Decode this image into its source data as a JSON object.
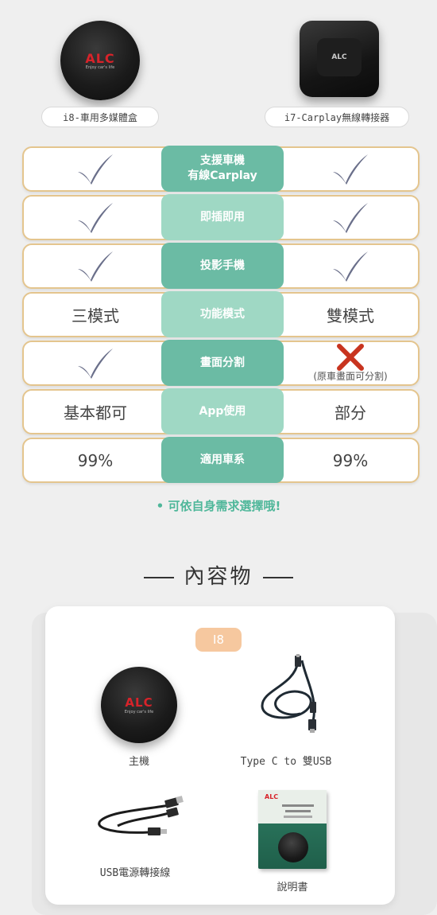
{
  "products": {
    "left": {
      "label": "i8-車用多媒體盒",
      "logo": "ALC",
      "tagline": "Enjoy car's life"
    },
    "right": {
      "label": "i7-Carplay無線轉接器",
      "logo": "ALC"
    }
  },
  "comparison": {
    "rows": [
      {
        "feature": "支援車機\n有線Carplay",
        "left": "check",
        "right": "check",
        "style": "dark"
      },
      {
        "feature": "即插即用",
        "left": "check",
        "right": "check",
        "style": "light"
      },
      {
        "feature": "投影手機",
        "left": "check",
        "right": "check",
        "style": "dark"
      },
      {
        "feature": "功能模式",
        "left": "三模式",
        "right": "雙模式",
        "style": "light"
      },
      {
        "feature": "畫面分割",
        "left": "check",
        "right": "cross",
        "right_note": "(原車畫面可分割)",
        "style": "dark"
      },
      {
        "feature": "App使用",
        "left": "基本都可",
        "right": "部分",
        "style": "light"
      },
      {
        "feature": "適用車系",
        "left": "99%",
        "right": "99%",
        "style": "dark"
      }
    ]
  },
  "tip": "• 可依自身需求選擇哦!",
  "contents": {
    "title": "內容物",
    "badge": "I8",
    "items": [
      {
        "label": "主機",
        "logo": "ALC",
        "tagline": "Enjoy car's life"
      },
      {
        "label": "Type C to 雙USB"
      },
      {
        "label": "USB電源轉接線"
      },
      {
        "label": "說明書",
        "cover_logo": "ALC"
      }
    ]
  },
  "colors": {
    "accent_dark": "#6bbba4",
    "accent_light": "#9fd8c4",
    "row_border": "#e4c58e",
    "check": "#6a6f8a",
    "cross": "#c8341f",
    "tip": "#4fb79a",
    "badge": "#f6c89f"
  }
}
